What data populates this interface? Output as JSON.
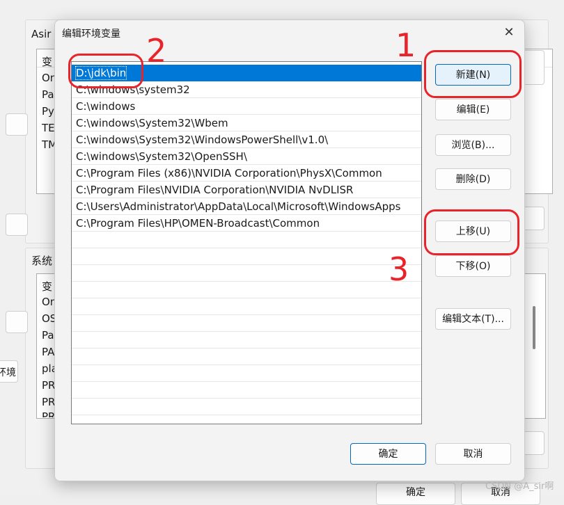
{
  "background": {
    "user_vars_label": "Asir",
    "user_var_rows": [
      "变",
      "On",
      "Pa",
      "Py",
      "TE",
      "TM"
    ],
    "env_button_label": "环境",
    "system_vars_label": "系统",
    "system_var_rows": [
      "变",
      "On",
      "OS",
      "Pa",
      "PA",
      "pla",
      "PR",
      "PR",
      "PR"
    ],
    "ok_label": "确定",
    "cancel_label": "取消"
  },
  "dialog": {
    "title": "编辑环境变量",
    "close_glyph": "✕",
    "paths": [
      "D:\\jdk\\bin",
      "C:\\windows\\system32",
      "C:\\windows",
      "C:\\windows\\System32\\Wbem",
      "C:\\windows\\System32\\WindowsPowerShell\\v1.0\\",
      "C:\\windows\\System32\\OpenSSH\\",
      "C:\\Program Files (x86)\\NVIDIA Corporation\\PhysX\\Common",
      "C:\\Program Files\\NVIDIA Corporation\\NVIDIA NvDLISR",
      "C:\\Users\\Administrator\\AppData\\Local\\Microsoft\\WindowsApps",
      "C:\\Program Files\\HP\\OMEN-Broadcast\\Common",
      "",
      "",
      "",
      "",
      "",
      "",
      "",
      "",
      "",
      "",
      "",
      ""
    ],
    "buttons": {
      "new": "新建(N)",
      "edit": "编辑(E)",
      "browse": "浏览(B)...",
      "delete": "删除(D)",
      "move_up": "上移(U)",
      "move_down": "下移(O)",
      "edit_text": "编辑文本(T)...",
      "ok": "确定",
      "cancel": "取消"
    }
  },
  "annotations": {
    "one": "1",
    "two": "2",
    "three": "3",
    "color": "#e8232a"
  },
  "watermark": "CSDN @A_sir啊"
}
